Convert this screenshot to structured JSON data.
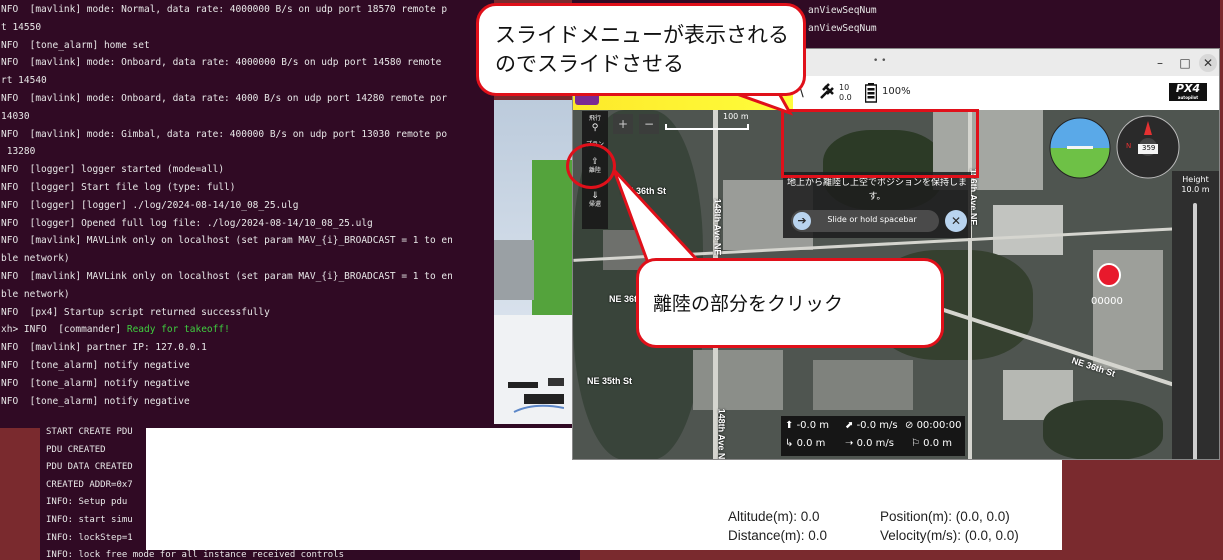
{
  "terminal_main": {
    "lines": [
      "NFO  [mavlink] mode: Normal, data rate: 4000000 B/s on udp port 18570 remote p",
      "t 14550",
      "NFO  [tone_alarm] home set",
      "NFO  [mavlink] mode: Onboard, data rate: 4000000 B/s on udp port 14580 remote",
      "rt 14540",
      "NFO  [mavlink] mode: Onboard, data rate: 4000 B/s on udp port 14280 remote por",
      "14030",
      "NFO  [mavlink] mode: Gimbal, data rate: 400000 B/s on udp port 13030 remote po",
      " 13280",
      "NFO  [logger] logger started (mode=all)",
      "NFO  [logger] Start file log (type: full)",
      "NFO  [logger] [logger] ./log/2024-08-14/10_08_25.ulg",
      "NFO  [logger] Opened full log file: ./log/2024-08-14/10_08_25.ulg",
      "NFO  [mavlink] MAVLink only on localhost (set param MAV_{i}_BROADCAST = 1 to en",
      "ble network)",
      "NFO  [mavlink] MAVLink only on localhost (set param MAV_{i}_BROADCAST = 1 to en",
      "ble network)",
      "NFO  [px4] Startup script returned successfully"
    ],
    "commander_prefix": "xh> INFO  [commander] ",
    "commander_msg": "Ready for takeoff!",
    "lines_after": [
      "NFO  [mavlink] partner IP: 127.0.0.1",
      "NFO  [tone_alarm] notify negative",
      "NFO  [tone_alarm] notify negative",
      "NFO  [tone_alarm] notify negative"
    ]
  },
  "terminal_bottom": {
    "lines": [
      "START CREATE PDU",
      "PDU CREATED",
      "PDU DATA CREATED",
      "CREATED ADDR=0x7",
      "INFO: Setup pdu",
      "INFO: start simu",
      "INFO: lockStep=1",
      "INFO: lock free mode for all instance received controls"
    ]
  },
  "terminal_right": {
    "lines": [
      "anViewSeqNum",
      "anViewSeqNum"
    ]
  },
  "info_panel": {
    "altitude": "Altitude(m): 0.0",
    "distance": "Distance(m): 0.0",
    "position": "Position(m): (0.0, 0.0)",
    "velocity": "Velocity(m/s): (0.0, 0.0)"
  },
  "qgc": {
    "window_buttons": [
      "–",
      "□",
      "✕"
    ],
    "gps_count": "10",
    "gps_hdop": "0.0",
    "battery": "100%",
    "brand": "PX4",
    "brand_sub": "autopilot",
    "scale": "100 m",
    "toolstrip": {
      "fly": "飛行",
      "plan": "プラン",
      "takeoff": "離陸",
      "return": "帰還"
    },
    "slide": {
      "message": "地上から離陸し上空でポジションを保持します。",
      "hint": "Slide or hold spacebar"
    },
    "roads": [
      "NE 36th St",
      "NE 36th St",
      "NE 35th St",
      "148th Ave NE",
      "156th Ave NE",
      "148th Ave NE",
      "NE 36th St"
    ],
    "compass_heading": "359",
    "compass_n": "N",
    "target_label": "00000",
    "height_title": "Height",
    "height_value": "10.0 m",
    "telemetry": {
      "alt": "-0.0 m",
      "vspeed": "-0.0 m/s",
      "time": "00:00:00",
      "dist": "0.0 m",
      "hspeed": "0.0 m/s",
      "home": "0.0 m"
    }
  },
  "callouts": {
    "top": "スライドメニューが表示されるのでスライドさせる",
    "middle": "離陸の部分をクリック"
  }
}
